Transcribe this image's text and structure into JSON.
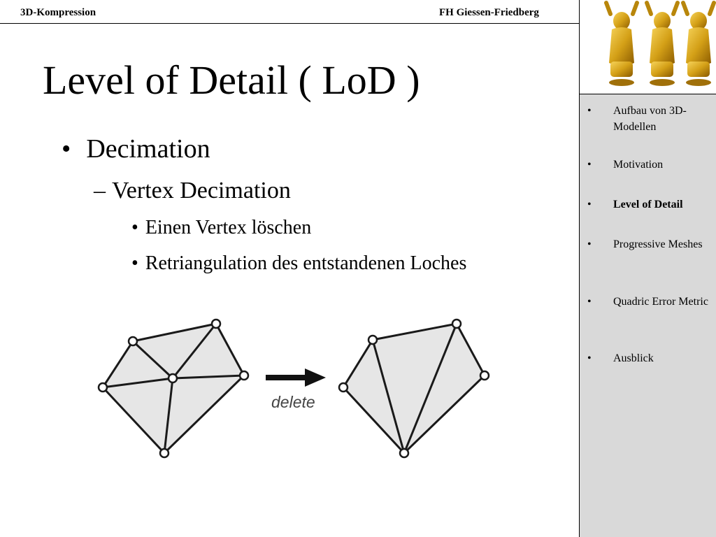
{
  "header": {
    "left": "3D-Kompression",
    "right": "FH Giessen-Friedberg"
  },
  "sidebar": {
    "bullet": "•",
    "items": [
      {
        "label": "Aufbau von 3D-Modellen",
        "active": false
      },
      {
        "label": "Motivation",
        "active": false
      },
      {
        "label": "Level of Detail",
        "active": true
      },
      {
        "label": "Progressive Meshes",
        "active": false
      },
      {
        "label": "Quadric Error Metric",
        "active": false
      },
      {
        "label": "Ausblick",
        "active": false
      }
    ]
  },
  "slide": {
    "title": "Level of Detail ( LoD )",
    "bullet_l1": "•",
    "item_l1": "Decimation",
    "dash_l2": "–",
    "item_l2": "Vertex Decimation",
    "bullet_l3": "•",
    "items_l3": [
      "Einen Vertex löschen",
      "Retriangulation des entstandenen Loches"
    ]
  },
  "figure": {
    "delete_label": "delete",
    "mesh_fill": "#e6e6e6",
    "edge_color": "#1a1a1a"
  },
  "colors": {
    "sidebar_bg": "#d9d9d9",
    "logo_gold": "#d4a017"
  }
}
